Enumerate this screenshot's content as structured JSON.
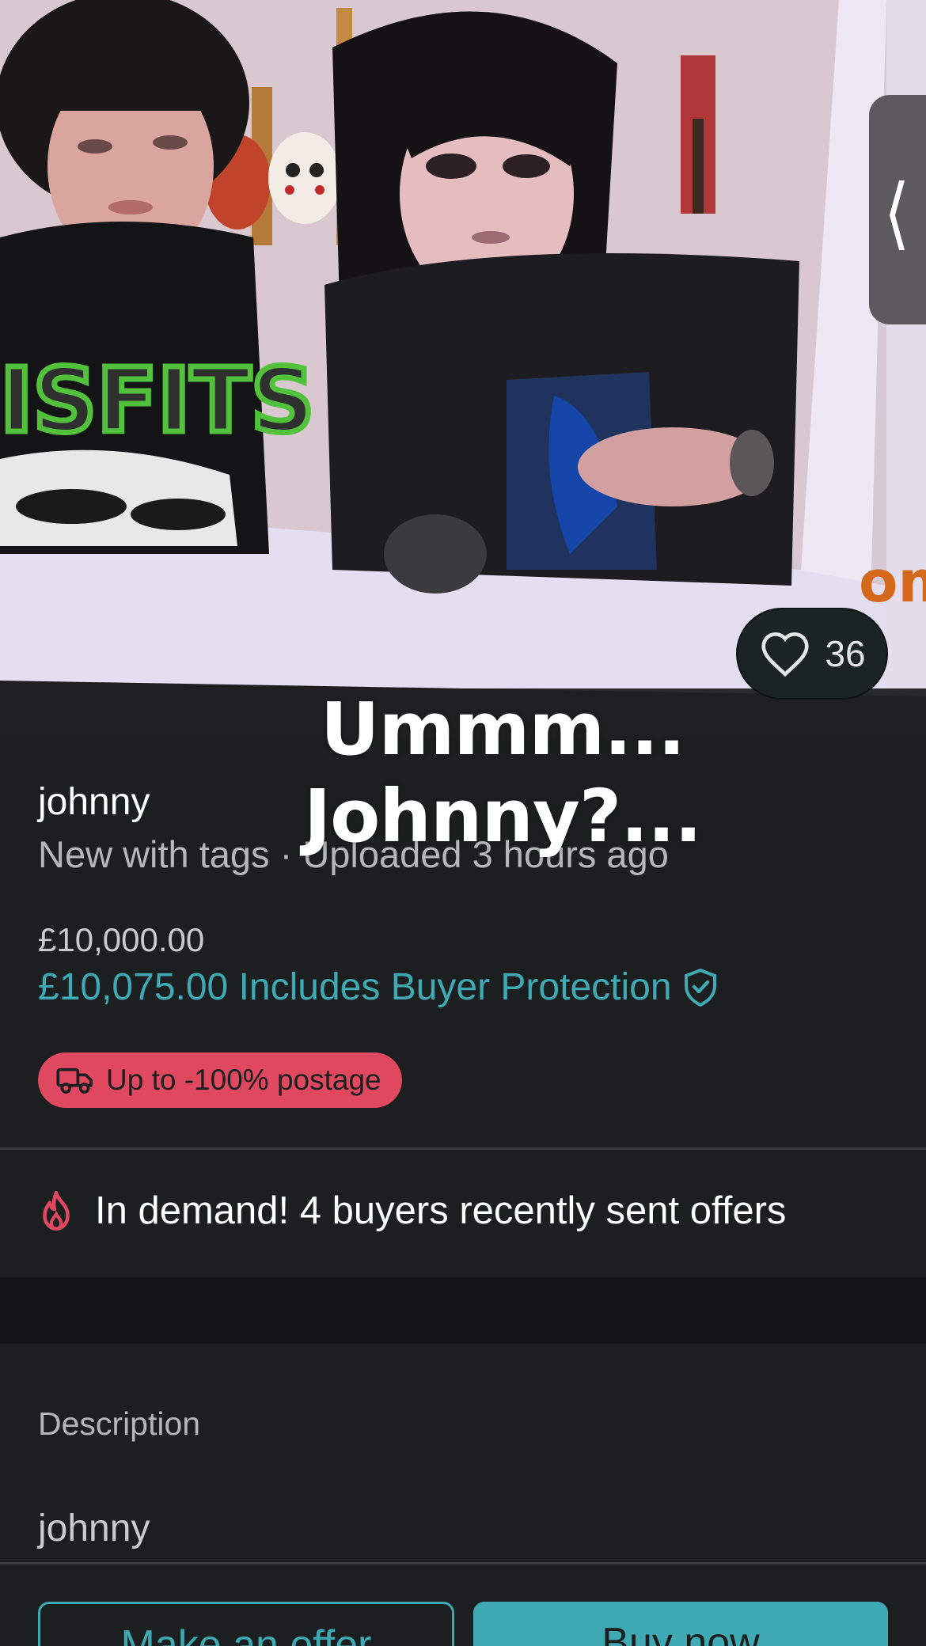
{
  "photo": {
    "alt_icons": [
      "person-left",
      "person-right",
      "guitar",
      "mask"
    ],
    "shirt_text": "MISFITS",
    "corner_text": "om",
    "like_count": "36"
  },
  "caption": {
    "line1": "Ummm...",
    "line2": "Johnny?..."
  },
  "listing": {
    "seller": "johnny",
    "meta": "New with tags · Uploaded 3 hours ago",
    "price": "£10,000.00",
    "price_with_protection": "£10,075.00 Includes Buyer Protection",
    "postage_badge": "Up to -100% postage",
    "demand_text": "In demand! 4 buyers recently sent offers"
  },
  "description": {
    "label": "Description",
    "text": "johnny"
  },
  "actions": {
    "offer_label": "Make an offer",
    "buy_label": "Buy now"
  },
  "colors": {
    "accent": "#3fa9b4",
    "badge": "#e0485f",
    "background": "#1b1f20"
  }
}
